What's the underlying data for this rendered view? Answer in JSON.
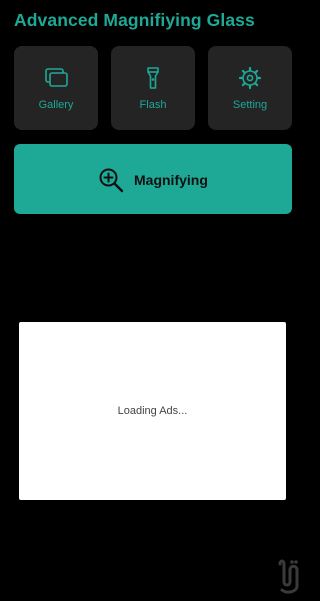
{
  "header": {
    "title": "Advanced Magnifiying Glass"
  },
  "tiles": [
    {
      "label": "Gallery",
      "icon": "gallery-icon"
    },
    {
      "label": "Flash",
      "icon": "flashlight-icon"
    },
    {
      "label": "Setting",
      "icon": "settings-icon"
    }
  ],
  "magnify_button": {
    "label": "Magnifying",
    "icon": "zoom-in-icon"
  },
  "ad": {
    "status": "Loading Ads..."
  },
  "colors": {
    "background": "#000000",
    "accent": "#1ea896",
    "tile_background": "#242424",
    "ad_background": "#ffffff"
  }
}
